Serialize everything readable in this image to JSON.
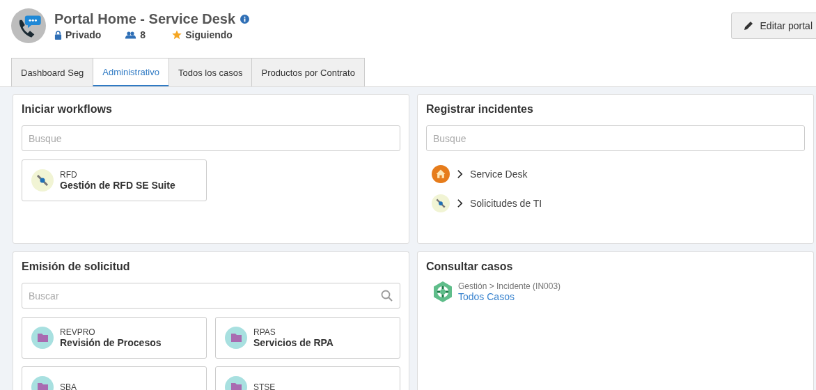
{
  "header": {
    "title": "Portal Home - Service Desk",
    "privacy": "Privado",
    "members": "8",
    "following": "Siguiendo",
    "edit_button": "Editar portal"
  },
  "tabs": [
    {
      "label": "Dashboard Seg",
      "selected": false
    },
    {
      "label": "Administrativo",
      "selected": true
    },
    {
      "label": "Todos los casos",
      "selected": false
    },
    {
      "label": "Productos por Contrato",
      "selected": false
    }
  ],
  "workflows": {
    "title": "Iniciar workflows",
    "search": {
      "placeholder": "Busque"
    },
    "tiles": [
      {
        "code": "RFD",
        "name": "Gestión de RFD SE Suite",
        "kind": "tool"
      }
    ]
  },
  "incidents": {
    "title": "Registrar incidentes",
    "search": {
      "placeholder": "Busque"
    },
    "items": [
      {
        "label": "Service Desk",
        "kind": "home"
      },
      {
        "label": "Solicitudes de TI",
        "kind": "tool"
      }
    ]
  },
  "requests": {
    "title": "Emisión de solicitud",
    "search": {
      "placeholder": "Buscar"
    },
    "tiles": [
      {
        "code": "REVPRO",
        "name": "Revisión de Procesos",
        "kind": "folder"
      },
      {
        "code": "RPAS",
        "name": "Servicios de RPA",
        "kind": "folder"
      },
      {
        "code": "SBA",
        "kind": "folder"
      },
      {
        "code": "STSE",
        "kind": "folder"
      }
    ]
  },
  "cases": {
    "title": "Consultar casos",
    "items": [
      {
        "path": "Gestión > Incidente (IN003)",
        "link": "Todos Casos",
        "kind": "lifebuoy"
      }
    ]
  }
}
